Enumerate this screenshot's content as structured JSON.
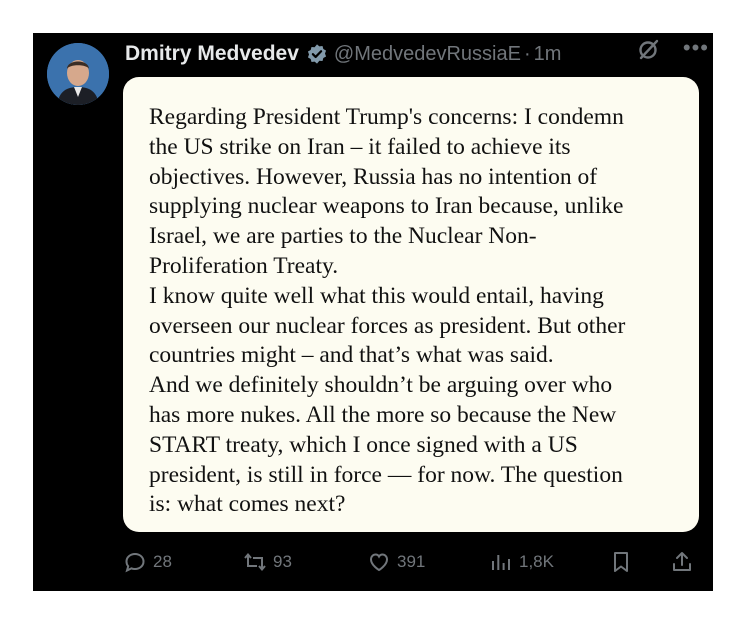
{
  "tweet": {
    "author_name": "Dmitry Medvedev",
    "handle": "@MedvedevRussiaE",
    "separator": "·",
    "time": "1m",
    "more_icon": "more-icon",
    "verified_icon": "verified-badge-icon",
    "grok_icon": "grok-icon",
    "body_lines": [
      "Regarding President Trump's concerns: I condemn",
      "the US strike on Iran – it failed to achieve its",
      "objectives. However, Russia has no intention of",
      "supplying nuclear weapons to Iran because, unlike",
      "Israel, we are parties to the Nuclear Non-",
      "Proliferation Treaty.",
      "I know quite well what this would entail, having",
      "overseen our nuclear forces as president. But other",
      "countries might – and that’s what was said.",
      "And we definitely shouldn’t be arguing over who",
      "has more nukes. All the more so because the New",
      "START treaty, which I once signed with a US",
      "president, is still in force — for now. The question",
      "is: what comes next?"
    ],
    "actions": {
      "replies": "28",
      "reposts": "93",
      "likes": "391",
      "views": "1,8K"
    }
  },
  "colors": {
    "background": "#000000",
    "name": "#e7e9ea",
    "muted": "#71767b",
    "verified": "#829aab",
    "card": "#fdfcf1"
  }
}
